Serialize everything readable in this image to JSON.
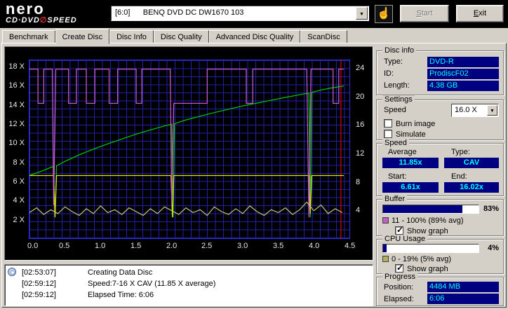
{
  "logo": {
    "brand": "nero",
    "product_left": "CD·DVD",
    "product_symbol": "∅",
    "product_right": "SPEED"
  },
  "toolbar": {
    "device": "[6:0]      BENQ DVD DC DW1670 103",
    "start_label": "Start",
    "exit_label": "Exit"
  },
  "tabs": [
    {
      "label": "Benchmark"
    },
    {
      "label": "Create Disc"
    },
    {
      "label": "Disc Info"
    },
    {
      "label": "Disc Quality"
    },
    {
      "label": "Advanced Disc Quality"
    },
    {
      "label": "ScanDisc"
    }
  ],
  "chart_data": {
    "type": "line",
    "x_max": 4.5,
    "x_ticks": [
      0,
      0.5,
      1,
      1.5,
      2,
      2.5,
      3,
      3.5,
      4,
      4.5
    ],
    "y_left_ticks": [
      18,
      16,
      14,
      12,
      10,
      8,
      6,
      4,
      2
    ],
    "y_left_unit": "X",
    "y_left_scale_max": 18.73,
    "y_right_ticks": [
      24,
      20,
      16,
      12,
      8,
      4
    ],
    "y_right_scale_max": 25.2,
    "background": "#000000",
    "grid": true,
    "grid_color": "#2020ae",
    "marker_lines": [
      {
        "x": 4.38,
        "color": "#b40000"
      }
    ],
    "series": [
      {
        "name": "write-speed",
        "color": "#00cc00",
        "points": [
          [
            0,
            6.61
          ],
          [
            0.15,
            7.0
          ],
          [
            0.3,
            7.45
          ],
          [
            0.34,
            7.55
          ],
          [
            0.36,
            2.2
          ],
          [
            0.38,
            7.62
          ],
          [
            0.5,
            8.1
          ],
          [
            0.7,
            8.78
          ],
          [
            0.9,
            9.38
          ],
          [
            1.1,
            9.93
          ],
          [
            1.3,
            10.45
          ],
          [
            1.5,
            10.95
          ],
          [
            1.7,
            11.4
          ],
          [
            1.9,
            11.82
          ],
          [
            2.0,
            12.0
          ],
          [
            2.02,
            2.2
          ],
          [
            2.04,
            12.05
          ],
          [
            2.2,
            12.45
          ],
          [
            2.4,
            12.85
          ],
          [
            2.6,
            13.22
          ],
          [
            2.8,
            13.58
          ],
          [
            3.0,
            13.92
          ],
          [
            3.2,
            14.22
          ],
          [
            3.4,
            14.52
          ],
          [
            3.6,
            14.82
          ],
          [
            3.8,
            15.1
          ],
          [
            3.93,
            15.28
          ],
          [
            3.95,
            2.2
          ],
          [
            3.97,
            15.35
          ],
          [
            4.1,
            15.6
          ],
          [
            4.25,
            15.82
          ],
          [
            4.42,
            16.02
          ]
        ]
      },
      {
        "name": "requested-speed",
        "color": "#e6e600",
        "points": [
          [
            0,
            6.6
          ],
          [
            0.34,
            6.6
          ],
          [
            0.36,
            2.2
          ],
          [
            0.38,
            6.6
          ],
          [
            1.99,
            6.6
          ],
          [
            2.01,
            2.2
          ],
          [
            2.03,
            6.6
          ],
          [
            3.93,
            6.6
          ],
          [
            3.95,
            2.6
          ],
          [
            3.97,
            6.6
          ],
          [
            4.42,
            6.6
          ]
        ]
      },
      {
        "name": "buffer-level",
        "color": "#d060d0",
        "points": [
          [
            0,
            17.8
          ],
          [
            0.12,
            17.8
          ],
          [
            0.12,
            14.2
          ],
          [
            0.2,
            14.2
          ],
          [
            0.2,
            17.8
          ],
          [
            0.32,
            17.8
          ],
          [
            0.34,
            3.5
          ],
          [
            0.37,
            17.8
          ],
          [
            0.55,
            17.8
          ],
          [
            0.55,
            14.2
          ],
          [
            0.66,
            14.2
          ],
          [
            0.66,
            17.8
          ],
          [
            0.8,
            17.8
          ],
          [
            0.8,
            14.2
          ],
          [
            0.92,
            14.2
          ],
          [
            0.92,
            17.8
          ],
          [
            1.12,
            17.8
          ],
          [
            1.12,
            14.2
          ],
          [
            1.24,
            14.2
          ],
          [
            1.24,
            17.8
          ],
          [
            1.5,
            17.8
          ],
          [
            1.5,
            14.2
          ],
          [
            1.58,
            14.2
          ],
          [
            1.58,
            17.8
          ],
          [
            1.98,
            17.8
          ],
          [
            2.0,
            3.5
          ],
          [
            2.03,
            14.2
          ],
          [
            2.5,
            14.2
          ],
          [
            2.5,
            17.8
          ],
          [
            3.05,
            17.8
          ],
          [
            3.05,
            14.2
          ],
          [
            3.14,
            14.2
          ],
          [
            3.14,
            17.8
          ],
          [
            3.9,
            17.8
          ],
          [
            3.93,
            2.2
          ],
          [
            3.96,
            17.8
          ],
          [
            4.27,
            17.8
          ],
          [
            4.27,
            14.2
          ],
          [
            4.35,
            14.2
          ],
          [
            4.35,
            17.8
          ],
          [
            4.42,
            17.8
          ]
        ]
      },
      {
        "name": "cpu-usage",
        "color": "#c8c870",
        "points": [
          [
            0,
            2.7
          ],
          [
            0.1,
            3.2
          ],
          [
            0.2,
            2.5
          ],
          [
            0.3,
            3.0
          ],
          [
            0.4,
            2.6
          ],
          [
            0.5,
            3.3
          ],
          [
            0.6,
            2.8
          ],
          [
            0.7,
            2.4
          ],
          [
            0.8,
            3.1
          ],
          [
            0.9,
            2.6
          ],
          [
            1.0,
            3.4
          ],
          [
            1.1,
            2.7
          ],
          [
            1.2,
            3.0
          ],
          [
            1.3,
            2.5
          ],
          [
            1.4,
            3.2
          ],
          [
            1.5,
            2.8
          ],
          [
            1.6,
            2.4
          ],
          [
            1.7,
            3.1
          ],
          [
            1.8,
            2.6
          ],
          [
            1.9,
            3.3
          ],
          [
            2.0,
            2.9
          ],
          [
            2.1,
            2.5
          ],
          [
            2.2,
            3.2
          ],
          [
            2.3,
            2.7
          ],
          [
            2.4,
            3.0
          ],
          [
            2.5,
            2.4
          ],
          [
            2.6,
            3.3
          ],
          [
            2.7,
            2.8
          ],
          [
            2.8,
            2.5
          ],
          [
            2.9,
            3.1
          ],
          [
            3.0,
            2.6
          ],
          [
            3.1,
            3.4
          ],
          [
            3.2,
            2.8
          ],
          [
            3.3,
            2.4
          ],
          [
            3.4,
            3.0
          ],
          [
            3.5,
            2.7
          ],
          [
            3.6,
            3.2
          ],
          [
            3.7,
            2.5
          ],
          [
            3.8,
            3.0
          ],
          [
            3.9,
            3.8
          ],
          [
            4.0,
            2.9
          ],
          [
            4.1,
            3.5
          ],
          [
            4.2,
            2.6
          ],
          [
            4.3,
            3.1
          ],
          [
            4.4,
            2.7
          ]
        ]
      }
    ]
  },
  "panels": {
    "disc_info": {
      "title": "Disc info",
      "rows": [
        {
          "label": "Type:",
          "value": "DVD-R"
        },
        {
          "label": "ID:",
          "value": "ProdiscF02"
        },
        {
          "label": "Length:",
          "value": "4.38 GB"
        }
      ]
    },
    "settings": {
      "title": "Settings",
      "speed_label": "Speed",
      "speed_value": "16.0 X",
      "burn_image_label": "Burn image",
      "burn_image_checked": false,
      "simulate_label": "Simulate",
      "simulate_checked": false
    },
    "speed": {
      "title": "Speed",
      "average_label": "Average",
      "average_value": "11.85x",
      "type_label": "Type:",
      "type_value": "CAV",
      "start_label": "Start:",
      "start_value": "6.61x",
      "end_label": "End:",
      "end_value": "16.02x"
    },
    "buffer": {
      "title": "Buffer",
      "percent": "83%",
      "percent_value": 83,
      "legend": "11 - 100% (89% avg)",
      "legend_color": "#c060c0",
      "show_graph_label": "Show graph",
      "show_graph_checked": true
    },
    "cpu": {
      "title": "CPU Usage",
      "percent": "4%",
      "percent_value": 4,
      "legend": "0 - 19% (5% avg)",
      "legend_color": "#b0b060",
      "show_graph_label": "Show graph",
      "show_graph_checked": true
    },
    "progress": {
      "title": "Progress",
      "position_label": "Position:",
      "position_value": "4484 MB",
      "elapsed_label": "Elapsed:",
      "elapsed_value": "6:06"
    }
  },
  "log": {
    "entries": [
      {
        "time": "[02:53:07]",
        "text": "Creating Data Disc"
      },
      {
        "time": "[02:59:12]",
        "text": "Speed:7-16 X CAV (11.85 X average)"
      },
      {
        "time": "[02:59:12]",
        "text": "Elapsed Time:  6:06"
      }
    ]
  }
}
